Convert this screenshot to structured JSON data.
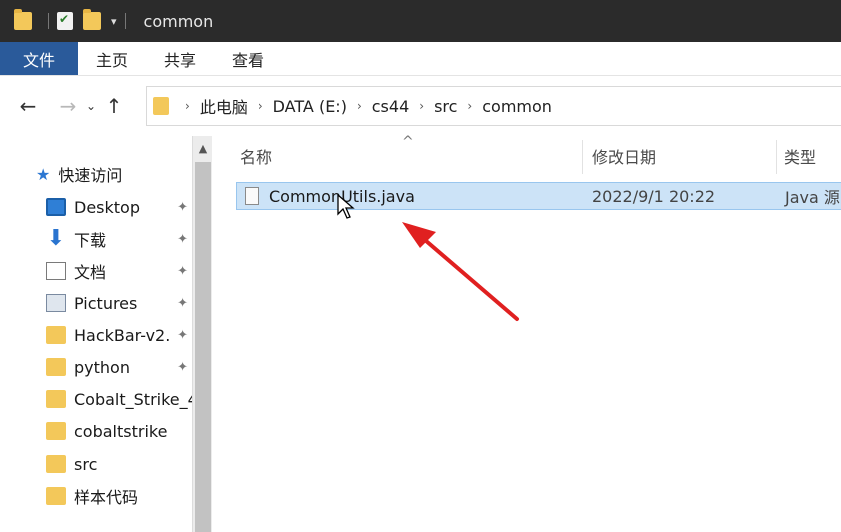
{
  "window": {
    "title": "common"
  },
  "ribbon": {
    "tabs": [
      "文件",
      "主页",
      "共享",
      "查看"
    ]
  },
  "address": {
    "crumbs": [
      "此电脑",
      "DATA (E:)",
      "cs44",
      "src",
      "common"
    ]
  },
  "nav": {
    "quick_access": "快速访问",
    "items": [
      {
        "label": "Desktop",
        "icon": "desktop-icon",
        "pinned": true
      },
      {
        "label": "下载",
        "icon": "download-icon",
        "pinned": true
      },
      {
        "label": "文档",
        "icon": "document-icon",
        "pinned": true
      },
      {
        "label": "Pictures",
        "icon": "pictures-icon",
        "pinned": true
      },
      {
        "label": "HackBar-v2.",
        "icon": "folder-icon",
        "pinned": true
      },
      {
        "label": "python",
        "icon": "folder-icon",
        "pinned": true
      },
      {
        "label": "Cobalt_Strike_4",
        "icon": "folder-icon",
        "pinned": false
      },
      {
        "label": "cobaltstrike",
        "icon": "folder-icon",
        "pinned": false
      },
      {
        "label": "src",
        "icon": "folder-icon",
        "pinned": false
      },
      {
        "label": "样本代码",
        "icon": "folder-icon",
        "pinned": false
      }
    ]
  },
  "list": {
    "headers": {
      "name": "名称",
      "date": "修改日期",
      "type": "类型"
    },
    "files": [
      {
        "name": "CommonUtils.java",
        "date": "2022/9/1 20:22",
        "type": "Java 源"
      }
    ]
  },
  "colors": {
    "file_tab": "#2a5a9a",
    "selection": "#cce3f7",
    "annotation_arrow": "#e02020"
  }
}
